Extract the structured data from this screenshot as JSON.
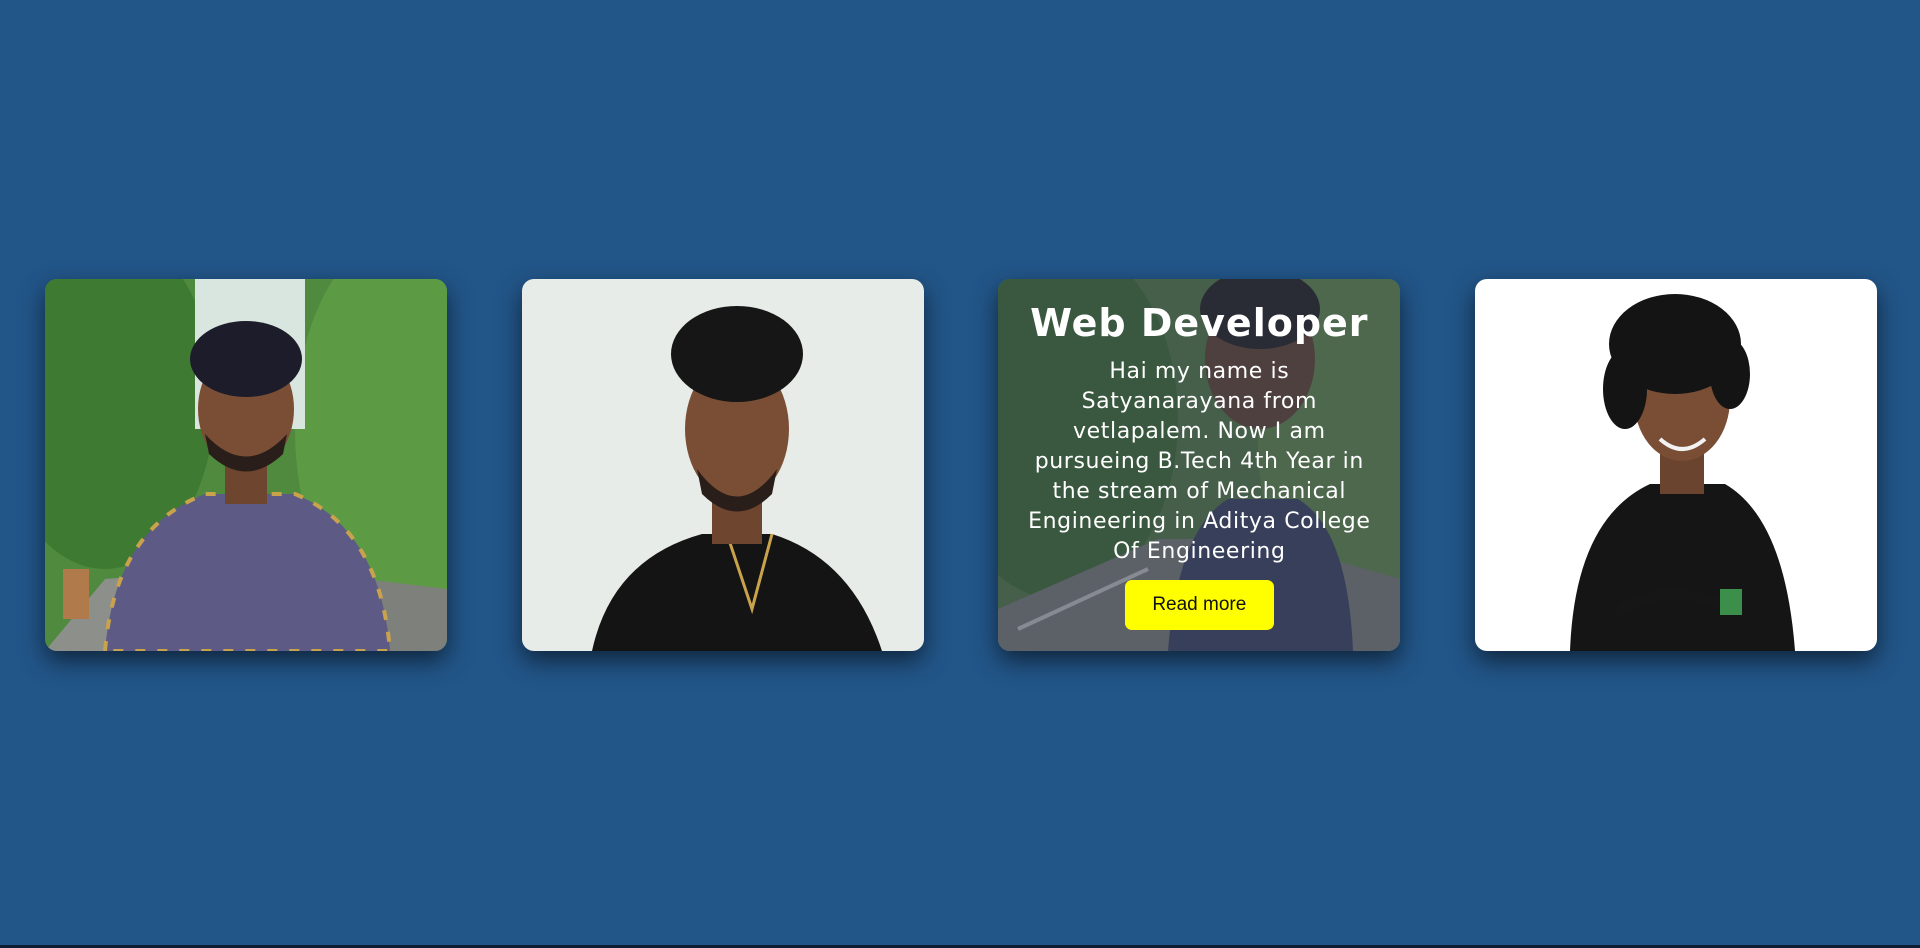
{
  "page": {
    "background": "#225588"
  },
  "cards": [
    {
      "photo": "portrait-photo-outdoor-checked-shirt"
    },
    {
      "photo": "portrait-photo-light-background-black-polo"
    },
    {
      "photo": "portrait-photo-road-background",
      "overlay": {
        "title": "Web Developer",
        "text": "Hai my name is Satyanarayana from vetlapalem. Now I am pursueing B.Tech 4th Year in the stream of Mechanical Engineering in Aditya College Of Engineering",
        "button_label": "Read more",
        "button_color": "#ffff00"
      }
    },
    {
      "photo": "portrait-photo-white-background-black-polo"
    }
  ]
}
